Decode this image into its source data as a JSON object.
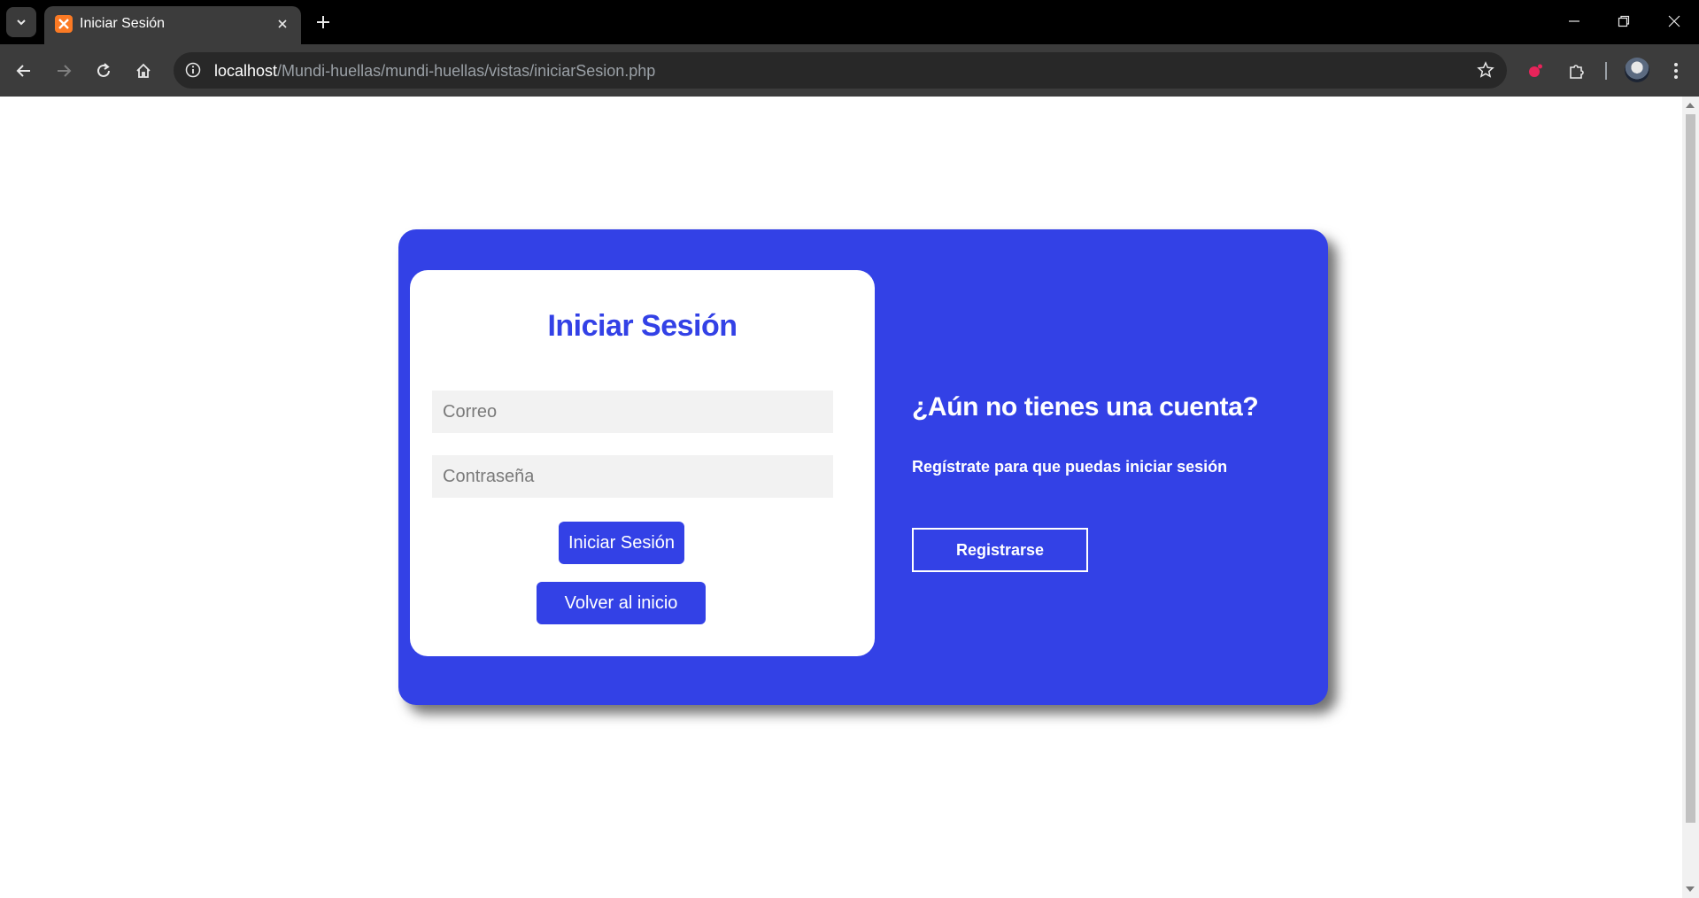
{
  "browser": {
    "tab_title": "Iniciar Sesión",
    "url_host": "localhost",
    "url_path": "/Mundi-huellas/mundi-huellas/vistas/iniciarSesion.php"
  },
  "login": {
    "title": "Iniciar Sesión",
    "email_placeholder": "Correo",
    "password_placeholder": "Contraseña",
    "login_button": "Iniciar Sesión",
    "home_button": "Volver al inicio"
  },
  "register": {
    "heading": "¿Aún no tienes una cuenta?",
    "subtext": "Regístrate para que puedas iniciar sesión",
    "button": "Registrarse"
  },
  "colors": {
    "brand": "#3341e6",
    "panel": "#ffffff",
    "input_bg": "#f2f2f2"
  }
}
